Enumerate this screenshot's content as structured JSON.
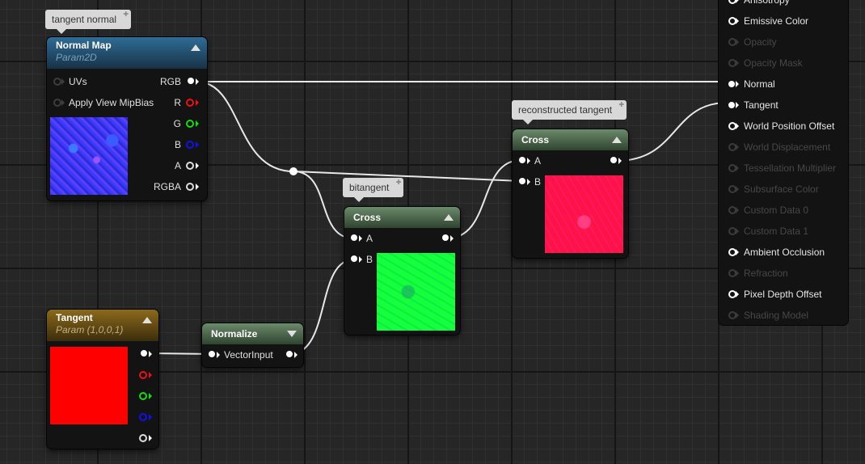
{
  "comments": {
    "tangent_normal": "tangent normal",
    "bitangent": "bitangent",
    "reconstructed_tangent": "reconstructed tangent"
  },
  "normal_map_node": {
    "title": "Normal Map",
    "subtitle": "Param2D",
    "inputs": [
      "UVs",
      "Apply View MipBias"
    ],
    "outputs": [
      "RGB",
      "R",
      "G",
      "B",
      "A",
      "RGBA"
    ]
  },
  "tangent_node": {
    "title": "Tangent",
    "subtitle": "Param (1,0,0,1)",
    "preview_color": "#ff0000"
  },
  "normalize_node": {
    "title": "Normalize",
    "input_label": "VectorInput"
  },
  "cross_bitangent_node": {
    "title": "Cross",
    "inputs": [
      "A",
      "B"
    ],
    "preview_color": "#14ff3c"
  },
  "cross_tangent_node": {
    "title": "Cross",
    "inputs": [
      "A",
      "B"
    ],
    "preview_color": "#ff1246"
  },
  "material_outputs": [
    {
      "label": "Anisotropy",
      "active": true
    },
    {
      "label": "Emissive Color",
      "active": true
    },
    {
      "label": "Opacity",
      "active": false
    },
    {
      "label": "Opacity Mask",
      "active": false
    },
    {
      "label": "Normal",
      "active": true,
      "connected": true
    },
    {
      "label": "Tangent",
      "active": true,
      "connected": true
    },
    {
      "label": "World Position Offset",
      "active": true
    },
    {
      "label": "World Displacement",
      "active": false
    },
    {
      "label": "Tessellation Multiplier",
      "active": false
    },
    {
      "label": "Subsurface Color",
      "active": false
    },
    {
      "label": "Custom Data 0",
      "active": false
    },
    {
      "label": "Custom Data 1",
      "active": false
    },
    {
      "label": "Ambient Occlusion",
      "active": true
    },
    {
      "label": "Refraction",
      "active": false
    },
    {
      "label": "Pixel Depth Offset",
      "active": true
    },
    {
      "label": "Shading Model",
      "active": false
    }
  ],
  "colors": {
    "wire": "#ffffff",
    "pin_red": "#ee1111",
    "pin_green": "#11dd11",
    "pin_blue": "#1111ee"
  }
}
